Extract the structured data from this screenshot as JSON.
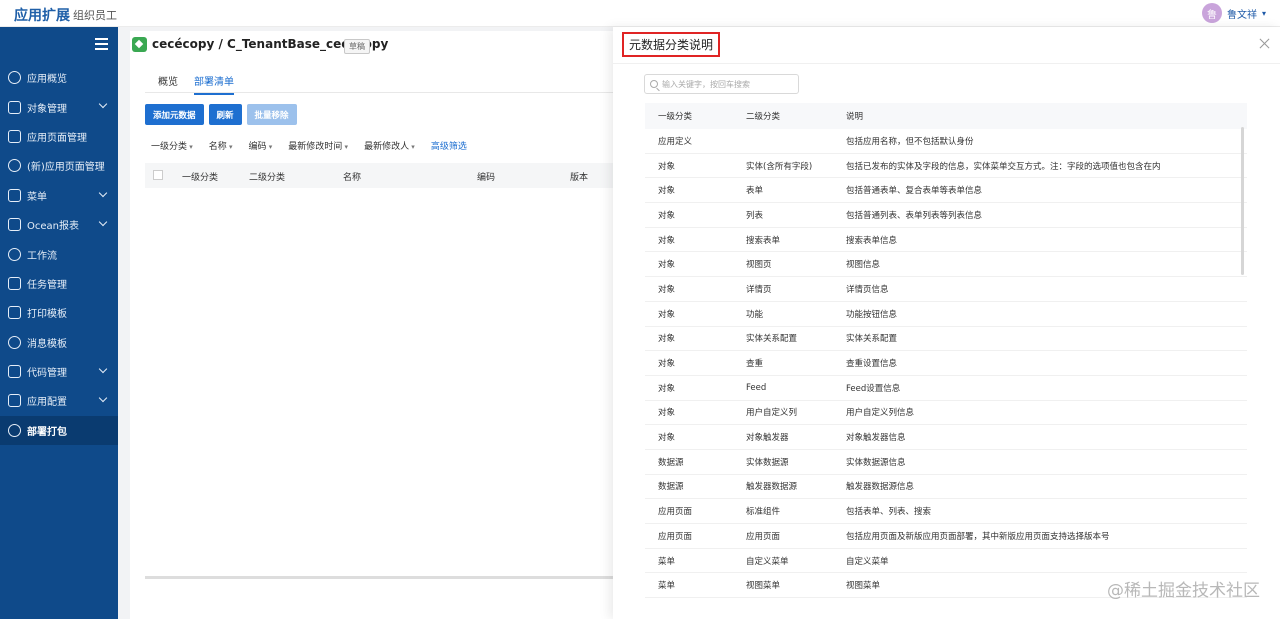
{
  "topbar": {
    "brand": "应用扩展",
    "org": "组织员工",
    "avatar_char": "鲁",
    "user_name": "鲁文祥",
    "user_caret": "▾"
  },
  "sidebar": {
    "items": [
      {
        "label": "应用概览",
        "icon": "overview-icon",
        "chevron": false,
        "active": false
      },
      {
        "label": "对象管理",
        "icon": "object-icon",
        "chevron": true,
        "active": false
      },
      {
        "label": "应用页面管理",
        "icon": "page-icon",
        "chevron": false,
        "active": false
      },
      {
        "label": "(新)应用页面管理",
        "icon": "new-page-icon",
        "chevron": false,
        "active": false
      },
      {
        "label": "菜单",
        "icon": "menu-icon",
        "chevron": true,
        "active": false
      },
      {
        "label": "Ocean报表",
        "icon": "report-icon",
        "chevron": true,
        "active": false
      },
      {
        "label": "工作流",
        "icon": "workflow-icon",
        "chevron": false,
        "active": false
      },
      {
        "label": "任务管理",
        "icon": "task-icon",
        "chevron": false,
        "active": false
      },
      {
        "label": "打印模板",
        "icon": "print-icon",
        "chevron": false,
        "active": false
      },
      {
        "label": "消息模板",
        "icon": "message-icon",
        "chevron": false,
        "active": false
      },
      {
        "label": "代码管理",
        "icon": "code-icon",
        "chevron": true,
        "active": false
      },
      {
        "label": "应用配置",
        "icon": "config-icon",
        "chevron": true,
        "active": false
      },
      {
        "label": "部署打包",
        "icon": "cloud-icon",
        "chevron": false,
        "active": true
      }
    ]
  },
  "main": {
    "app_title": "cecécopy / C_TenantBase_cececopy",
    "draft_badge": "草稿",
    "tabs": [
      {
        "label": "概览",
        "active": false
      },
      {
        "label": "部署清单",
        "active": true
      }
    ],
    "buttons": {
      "add": "添加元数据",
      "refresh": "刷新",
      "batch_remove": "批量移除"
    },
    "filters": [
      "一级分类",
      "名称",
      "编码",
      "最新修改时间",
      "最新修改人"
    ],
    "advanced_filter": "高级筛选",
    "grid_columns": [
      "一级分类",
      "二级分类",
      "名称",
      "编码",
      "版本"
    ]
  },
  "drawer": {
    "title": "元数据分类说明",
    "search_placeholder": "输入关键字，按回车搜索",
    "columns": [
      "一级分类",
      "二级分类",
      "说明"
    ],
    "rows": [
      [
        "应用定义",
        "",
        "包括应用名称，但不包括默认身份"
      ],
      [
        "对象",
        "实体(含所有字段)",
        "包括已发布的实体及字段的信息，实体菜单交互方式。注：字段的选项值也包含在内"
      ],
      [
        "对象",
        "表单",
        "包括普通表单、复合表单等表单信息"
      ],
      [
        "对象",
        "列表",
        "包括普通列表、表单列表等列表信息"
      ],
      [
        "对象",
        "搜索表单",
        "搜索表单信息"
      ],
      [
        "对象",
        "视图页",
        "视图信息"
      ],
      [
        "对象",
        "详情页",
        "详情页信息"
      ],
      [
        "对象",
        "功能",
        "功能按钮信息"
      ],
      [
        "对象",
        "实体关系配置",
        "实体关系配置"
      ],
      [
        "对象",
        "查重",
        "查重设置信息"
      ],
      [
        "对象",
        "Feed",
        "Feed设置信息"
      ],
      [
        "对象",
        "用户自定义列",
        "用户自定义列信息"
      ],
      [
        "对象",
        "对象触发器",
        "对象触发器信息"
      ],
      [
        "数据源",
        "实体数据源",
        "实体数据源信息"
      ],
      [
        "数据源",
        "触发器数据源",
        "触发器数据源信息"
      ],
      [
        "应用页面",
        "标准组件",
        "包括表单、列表、搜索"
      ],
      [
        "应用页面",
        "应用页面",
        "包括应用页面及新版应用页面部署，其中新版应用页面支持选择版本号"
      ],
      [
        "菜单",
        "自定义菜单",
        "自定义菜单"
      ],
      [
        "菜单",
        "视图菜单",
        "视图菜单"
      ]
    ]
  },
  "watermark": "@稀土掘金技术社区",
  "colors": {
    "sidebar": "#0f4a8a",
    "accent": "#1e6fd0",
    "highlight_border": "#e02424"
  }
}
